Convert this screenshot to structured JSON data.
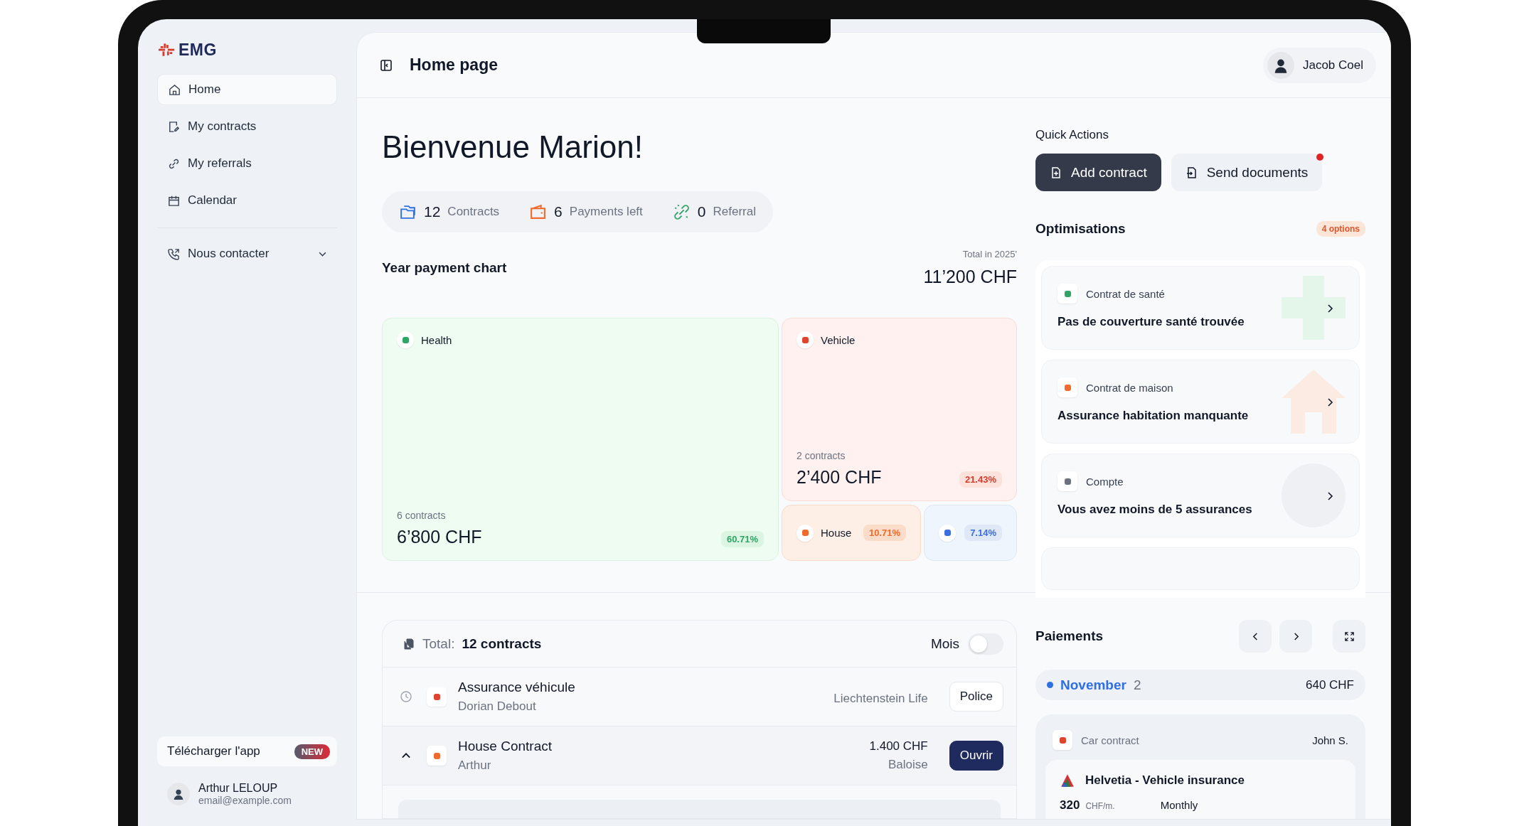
{
  "logo": {
    "text": "EMG"
  },
  "sidebar": {
    "items": [
      {
        "label": "Home",
        "kind": "home",
        "selected": true
      },
      {
        "label": "My contracts",
        "kind": "contracts",
        "selected": false
      },
      {
        "label": "My referrals",
        "kind": "referrals",
        "selected": false
      },
      {
        "label": "Calendar",
        "kind": "calendar",
        "selected": false
      }
    ],
    "contact": {
      "label": "Nous contacter",
      "expanded": false
    },
    "promo": {
      "label": "Télécharger l'app",
      "badge": "NEW"
    },
    "user": {
      "name": "Arthur LELOUP",
      "email": "email@example.com"
    }
  },
  "header": {
    "title": "Home page",
    "user": "Jacob Coel"
  },
  "greeting": "Bienvenue Marion!",
  "stats": [
    {
      "kind": "contracts",
      "value": "12",
      "label": "Contracts"
    },
    {
      "kind": "payments",
      "value": "6",
      "label": "Payments left"
    },
    {
      "kind": "referral",
      "value": "0",
      "label": "Referral"
    }
  ],
  "payment_chart": {
    "title": "Year payment chart",
    "total_label": "Total in 2025'",
    "total": "11’200 CHF",
    "tiles": [
      {
        "kind": "health",
        "label": "Health",
        "contracts": "6 contracts",
        "amount": "6’800 CHF",
        "percent": "60.71%"
      },
      {
        "kind": "vehicle",
        "label": "Vehicle",
        "contracts": "2 contracts",
        "amount": "2’400 CHF",
        "percent": "21.43%"
      },
      {
        "kind": "house",
        "label": "House",
        "percent": "10.71%"
      },
      {
        "kind": "other",
        "percent": "7.14%"
      }
    ]
  },
  "quick_actions": {
    "title": "Quick Actions",
    "buttons": [
      {
        "label": "Add contract",
        "primary": true,
        "notification": false
      },
      {
        "label": "Send documents",
        "primary": false,
        "notification": true
      }
    ]
  },
  "optimisations": {
    "title": "Optimisations",
    "badge": "4 options",
    "items": [
      {
        "kind": "health",
        "category": "Contrat de santé",
        "text": "Pas de couverture santé trouvée"
      },
      {
        "kind": "house",
        "category": "Contrat de maison",
        "text": "Assurance habitation manquante"
      },
      {
        "kind": "account",
        "category": "Compte",
        "text": "Vous avez moins de 5 assurances"
      }
    ]
  },
  "contracts": {
    "total_label": "Total:",
    "total": "12 contracts",
    "toggle": {
      "label": "Mois",
      "on": false
    },
    "rows": [
      {
        "kind": "vehicle",
        "expanded": false,
        "title": "Assurance véhicule",
        "person": "Dorian Debout",
        "insurer": "Liechtenstein Life",
        "button": {
          "label": "Police",
          "primary": false
        }
      },
      {
        "kind": "house",
        "expanded": true,
        "title": "House Contract",
        "person": "Arthur",
        "amount": "1.400 CHF",
        "insurer": "Baloise",
        "button": {
          "label": "Ouvrir",
          "primary": true
        }
      }
    ]
  },
  "payments": {
    "title": "Paiements",
    "month": {
      "name": "November",
      "count": "2",
      "total": "640 CHF"
    },
    "card": {
      "category": "Car contract",
      "person": "John S.",
      "title": "Helvetia - Vehicle insurance",
      "amount": "320",
      "unit": "CHF/m.",
      "frequency": "Monthly"
    }
  }
}
